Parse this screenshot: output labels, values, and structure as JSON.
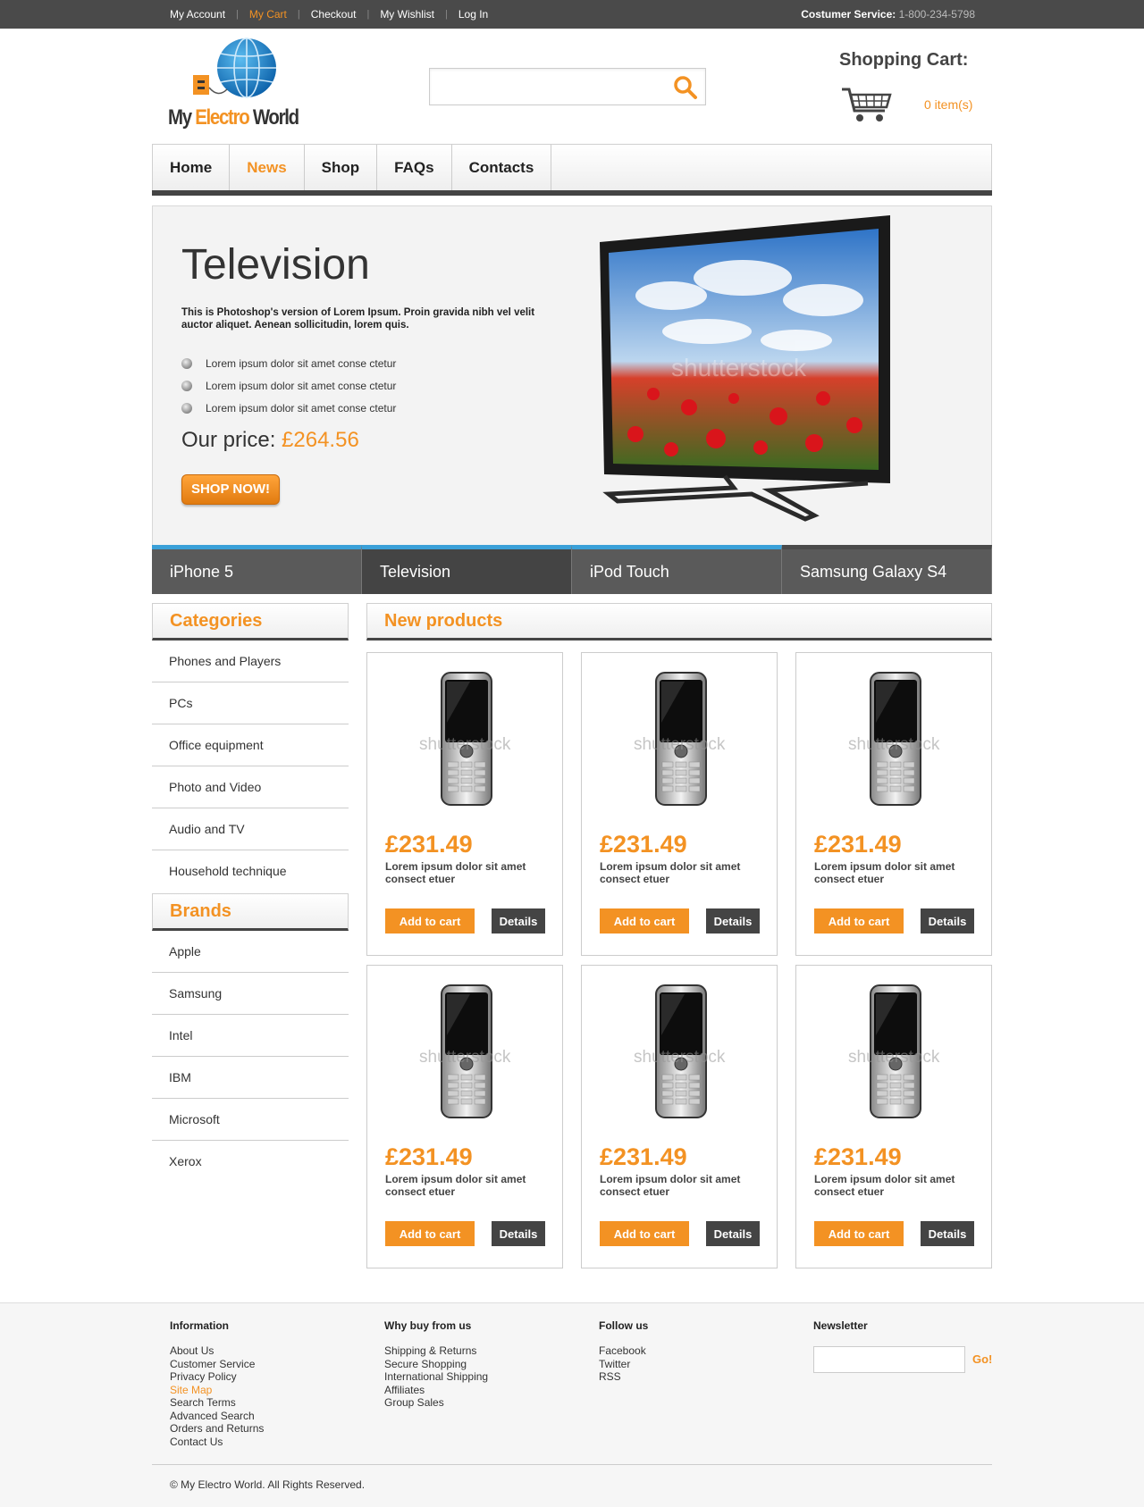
{
  "topbar": {
    "links": [
      "My Account",
      "My Cart",
      "Checkout",
      "My Wishlist",
      "Log In"
    ],
    "service_label": "Costumer Service:",
    "service_phone": "1-800-234-5798"
  },
  "logo": {
    "part1": "My ",
    "part2": "Electro",
    "part3": " World"
  },
  "search": {
    "value": "",
    "placeholder": ""
  },
  "cart": {
    "title": "Shopping Cart:",
    "count": "0 item(s)"
  },
  "nav": [
    "Home",
    "News",
    "Shop",
    "FAQs",
    "Contacts"
  ],
  "slide": {
    "title": "Television",
    "description": "This is Photoshop's version  of Lorem Ipsum. Proin gravida nibh vel velit auctor aliquet. Aenean sollicitudin, lorem quis.",
    "bullets": [
      "Lorem ipsum dolor sit amet conse ctetur",
      "Lorem ipsum dolor sit amet conse ctetur",
      "Lorem ipsum dolor sit amet conse ctetur"
    ],
    "price_label": "Our price: ",
    "price": "£264.56",
    "button": "SHOP NOW!"
  },
  "tabs": [
    "iPhone 5",
    "Television",
    "iPod Touch",
    "Samsung Galaxy S4"
  ],
  "categories": {
    "title": "Categories",
    "items": [
      "Phones and Players",
      "PCs",
      "Office equipment",
      "Photo and Video",
      "Audio and TV",
      "Household technique"
    ]
  },
  "brands": {
    "title": "Brands",
    "items": [
      "Apple",
      "Samsung",
      "Intel",
      "IBM",
      "Microsoft",
      "Xerox"
    ]
  },
  "products": {
    "title": "New products",
    "watermark": "shutterstock",
    "items": [
      {
        "price": "£231.49",
        "desc": "Lorem ipsum dolor sit amet consect etuer",
        "add": "Add to cart",
        "details": "Details"
      },
      {
        "price": "£231.49",
        "desc": "Lorem ipsum dolor sit amet consect etuer",
        "add": "Add to cart",
        "details": "Details"
      },
      {
        "price": "£231.49",
        "desc": "Lorem ipsum dolor sit amet consect etuer",
        "add": "Add to cart",
        "details": "Details"
      },
      {
        "price": "£231.49",
        "desc": "Lorem ipsum dolor sit amet consect etuer",
        "add": "Add to cart",
        "details": "Details"
      },
      {
        "price": "£231.49",
        "desc": "Lorem ipsum dolor sit amet consect etuer",
        "add": "Add to cart",
        "details": "Details"
      },
      {
        "price": "£231.49",
        "desc": "Lorem ipsum dolor sit amet consect etuer",
        "add": "Add to cart",
        "details": "Details"
      }
    ]
  },
  "footer": {
    "information": {
      "title": "Information",
      "links": [
        "About Us",
        "Customer Service",
        "Privacy Policy",
        "Site Map",
        "Search Terms",
        "Advanced Search",
        "Orders and Returns",
        "Contact Us"
      ]
    },
    "why": {
      "title": "Why buy from us",
      "links": [
        "Shipping & Returns",
        "Secure Shopping",
        "International Shipping",
        "Affiliates",
        "Group Sales"
      ]
    },
    "follow": {
      "title": "Follow us",
      "links": [
        "Facebook",
        "Twitter",
        "RSS"
      ]
    },
    "newsletter": {
      "title": "Newsletter",
      "value": "",
      "button": "Go!"
    },
    "copyright": "© My Electro World. All Rights Reserved."
  },
  "colors": {
    "accent": "#f39223",
    "dark": "#444444",
    "topbar": "#4a4a4a",
    "tab_highlight": "#3aa0d8"
  }
}
